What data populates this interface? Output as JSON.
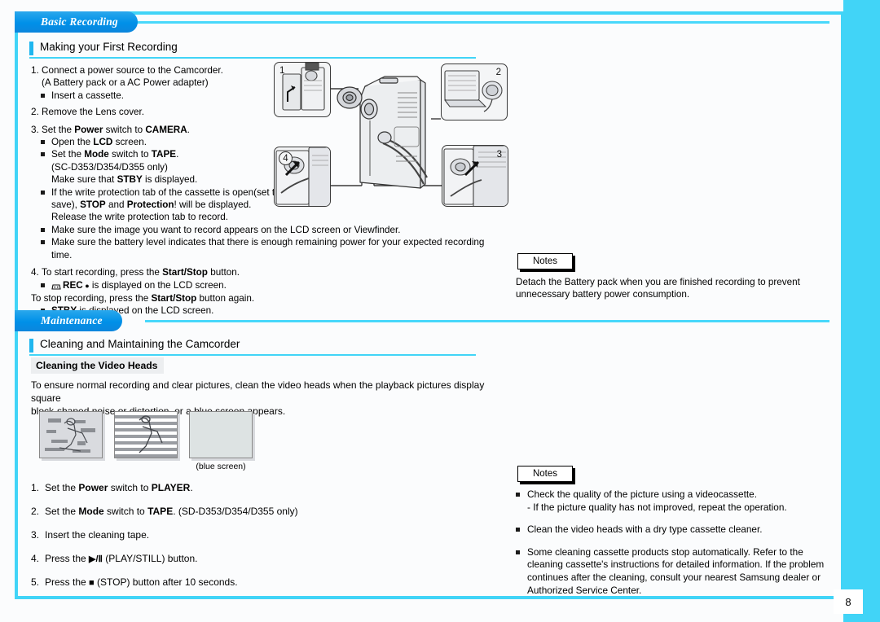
{
  "page": {
    "number": "8",
    "accent_cyan": "#41d4f7",
    "accent_blue": "#0090e8",
    "bg": "#fbfcfd"
  },
  "chapter1": {
    "title": "Basic Recording",
    "section_heading": "Making your First Recording"
  },
  "recording_steps": {
    "step1_num": "1.",
    "step1_text": "Connect a power source to the Camcorder.",
    "step1_sub": "(A Battery pack or a AC Power adapter)",
    "step1_bullet": "Insert a cassette.",
    "step2_num": "2.",
    "step2_text": "Remove the Lens cover.",
    "step3_num": "3.",
    "step3_a": "Set the ",
    "step3_b": "Power",
    "step3_c": " switch to ",
    "step3_d": "CAMERA",
    "step3_e": ".",
    "b1_a": "Open the ",
    "b1_b": "LCD",
    "b1_c": " screen.",
    "b2_a": "Set the ",
    "b2_b": "Mode",
    "b2_c": " switch to ",
    "b2_d": "TAPE",
    "b2_e": ".",
    "b2_line2": "(SC-D353/D354/D355 only)",
    "b2_line3_a": "Make sure that ",
    "b2_line3_b": "STBY",
    "b2_line3_c": " is displayed.",
    "b3_line1": "If the write protection tab of the cassette is open(set to",
    "b3_line2_a": "save), ",
    "b3_line2_b": "STOP",
    "b3_line2_c": " and ",
    "b3_line2_d": "Protection",
    "b3_line2_e": "! will be displayed.",
    "b3_line3": "Release the write protection tab to record.",
    "b4": "Make sure the image you want to record appears on the LCD screen or Viewfinder.",
    "b5_line1": "Make sure the battery level indicates that there is enough remaining power for your expected recording",
    "b5_line2": "time.",
    "step4_num": "4.",
    "step4_a": "To start recording, press the ",
    "step4_b": "Start/Stop",
    "step4_c": " button.",
    "b6_icon": "cassette-icon",
    "b6_a": "REC",
    "b6_dot": "●",
    "b6_c": " is displayed on the LCD screen.",
    "stop_a": "To stop recording, press the ",
    "stop_b": "Start/Stop",
    "stop_c": " button again.",
    "b7_a": "STBY",
    "b7_b": " is displayed on the LCD screen."
  },
  "figure": {
    "name": "camcorder-setup-diagram",
    "callout1": "1",
    "callout2": "2",
    "callout3": "3",
    "callout4": "4"
  },
  "notes1": {
    "label": "Notes",
    "line1": "Detach the Battery pack when you are finished recording to prevent",
    "line2": "unnecessary battery power consumption."
  },
  "chapter2": {
    "title": "Maintenance",
    "section_heading": "Cleaning and Maintaining the Camcorder",
    "sub_heading": "Cleaning the Video Heads",
    "intro_line1": "To ensure normal recording and clear pictures, clean the video heads when the playback pictures display square",
    "intro_line2": "block-shaped noise or distortion, or a blue screen appears.",
    "thumb_caption": "(blue screen)"
  },
  "maintenance_steps": [
    {
      "num": "1.",
      "parts": [
        {
          "t": "Set the ",
          "b": false
        },
        {
          "t": "Power",
          "b": true
        },
        {
          "t": " switch to ",
          "b": false
        },
        {
          "t": "PLAYER",
          "b": true
        },
        {
          "t": ".",
          "b": false
        }
      ]
    },
    {
      "num": "2.",
      "parts": [
        {
          "t": "Set the ",
          "b": false
        },
        {
          "t": "Mode",
          "b": true
        },
        {
          "t": " switch to ",
          "b": false
        },
        {
          "t": "TAPE",
          "b": true
        },
        {
          "t": ". (SD-D353/D354/D355 only)",
          "b": false
        }
      ]
    },
    {
      "num": "3.",
      "parts": [
        {
          "t": "Insert the cleaning tape.",
          "b": false
        }
      ]
    },
    {
      "num": "4.",
      "parts": [
        {
          "t": "Press the ",
          "b": false
        },
        {
          "t": "▶/Ⅱ",
          "b": true,
          "icon": "play-still-icon"
        },
        {
          "t": " (PLAY/STILL) button.",
          "b": false
        }
      ]
    },
    {
      "num": "5.",
      "parts": [
        {
          "t": "Press the ",
          "b": false
        },
        {
          "t": "■",
          "b": true,
          "icon": "stop-icon"
        },
        {
          "t": " (STOP) button after 10 seconds.",
          "b": false
        }
      ]
    }
  ],
  "notes2": {
    "label": "Notes",
    "items": [
      {
        "line1": "Check the quality of the picture using a videocassette.",
        "line2": "- If the picture quality has not improved, repeat the operation."
      },
      {
        "line1": "Clean the video heads with a dry type cassette cleaner."
      },
      {
        "line1": "Some cleaning cassette products stop automatically. Refer to the",
        "line2": "cleaning cassette's instructions for detailed information. If the problem",
        "line3": "continues after the cleaning, consult your nearest Samsung dealer or",
        "line4": "Authorized Service Center."
      }
    ]
  }
}
